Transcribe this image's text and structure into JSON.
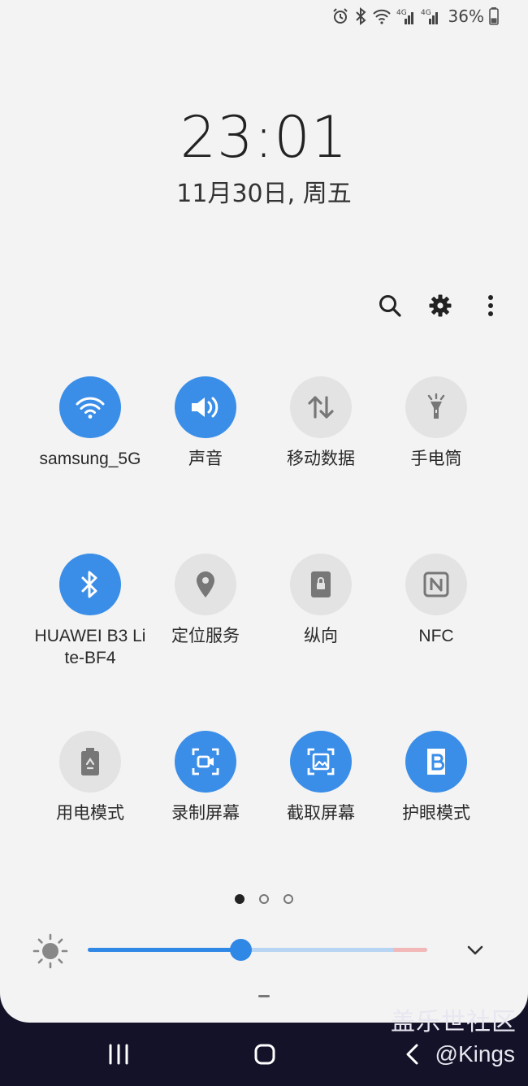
{
  "status_bar": {
    "icons": [
      "alarm-icon",
      "bluetooth-icon",
      "wifi-icon",
      "signal-4g-icon",
      "signal-4g-icon",
      "battery-icon"
    ],
    "network_label_1": "4G",
    "network_label_2": "4G",
    "battery_text": "36%",
    "battery_level": 0.36
  },
  "lock": {
    "time": "23:01",
    "date": "11月30日, 周五"
  },
  "header": {
    "icons": [
      "search-icon",
      "gear-icon",
      "more-vertical-icon"
    ]
  },
  "tiles": [
    {
      "label": "samsung_5G",
      "icon": "wifi-icon",
      "active": true
    },
    {
      "label": "声音",
      "icon": "volume-icon",
      "active": true
    },
    {
      "label": "移动数据",
      "icon": "data-transfer-icon",
      "active": false
    },
    {
      "label": "手电筒",
      "icon": "flashlight-icon",
      "active": false
    },
    {
      "label": "HUAWEI B3 Lite-BF4",
      "icon": "bluetooth-icon",
      "active": true
    },
    {
      "label": "定位服务",
      "icon": "location-icon",
      "active": false
    },
    {
      "label": "纵向",
      "icon": "portrait-lock-icon",
      "active": false
    },
    {
      "label": "NFC",
      "icon": "nfc-icon",
      "active": false
    },
    {
      "label": "用电模式",
      "icon": "battery-saver-icon",
      "active": false
    },
    {
      "label": "录制屏幕",
      "icon": "screen-record-icon",
      "active": true
    },
    {
      "label": "截取屏幕",
      "icon": "screenshot-icon",
      "active": true
    },
    {
      "label": "护眼模式",
      "icon": "blue-light-filter-icon",
      "active": true
    }
  ],
  "pagination": {
    "total": 3,
    "current": 1
  },
  "brightness": {
    "level": 0.45,
    "icon": "sun-icon"
  },
  "colors": {
    "accent": "#3a8ee8",
    "tile_off": "#e3e3e3",
    "panel": "#f3f3f3",
    "nav": "#141229"
  },
  "nav": {
    "icons": [
      "recent-apps-icon",
      "home-icon",
      "back-icon"
    ]
  },
  "watermark": {
    "line1": "盖乐世社区",
    "line2": "@Kings"
  }
}
